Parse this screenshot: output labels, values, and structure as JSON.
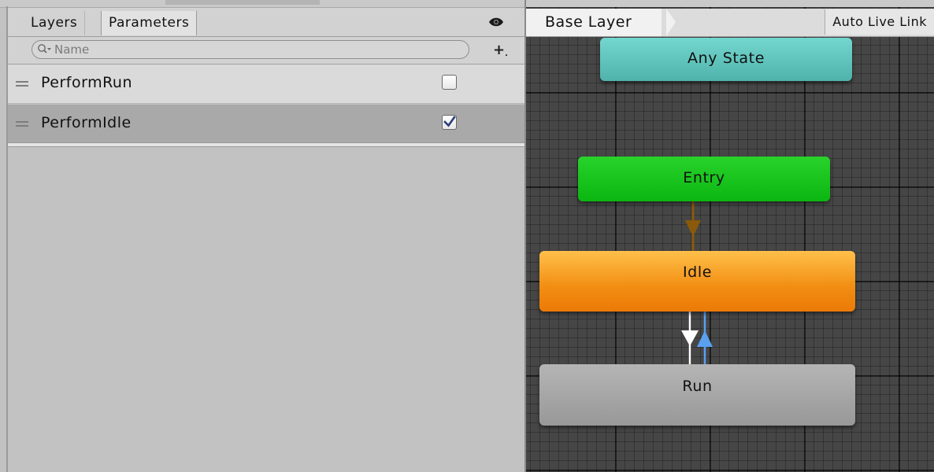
{
  "left_panel": {
    "tabs": [
      {
        "label": "Layers",
        "active": false
      },
      {
        "label": "Parameters",
        "active": true
      }
    ],
    "search": {
      "placeholder": "Name",
      "value": ""
    },
    "parameters": [
      {
        "name": "PerformRun",
        "type": "bool",
        "checked": false,
        "selected": false
      },
      {
        "name": "PerformIdle",
        "type": "bool",
        "checked": true,
        "selected": true
      }
    ]
  },
  "graph": {
    "breadcrumb": "Base Layer",
    "auto_live_link_label": "Auto Live Link",
    "states": [
      {
        "name": "Any State",
        "color": "#5fc4bc"
      },
      {
        "name": "Entry",
        "color": "#16c41a"
      },
      {
        "name": "Idle",
        "color": "#f28d12"
      },
      {
        "name": "Run",
        "color": "#a6a6a6"
      }
    ],
    "transitions": [
      {
        "from": "Entry",
        "to": "Idle",
        "color": "#8a5a0a"
      },
      {
        "from": "Idle",
        "to": "Run",
        "color": "#ffffff"
      },
      {
        "from": "Run",
        "to": "Idle",
        "color": "#5aa0f0"
      }
    ],
    "grid_color": "#464646"
  }
}
